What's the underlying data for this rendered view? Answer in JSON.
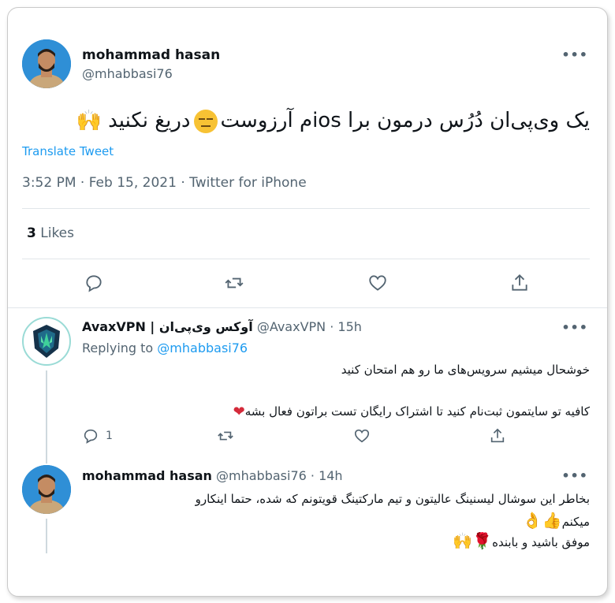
{
  "tweet": {
    "author_name": "mohammad hasan",
    "author_handle": "@mhabbasi76",
    "more_label": "•••",
    "text_before_emoji": "یک وی‌پی‌ان دُرُس درمون برا iosم آرزوست",
    "text_after_emoji": "دریغ نکنید",
    "translate_label": "Translate Tweet",
    "timestamp": "3:52 PM · Feb 15, 2021 · Twitter for iPhone",
    "likes_count": "3",
    "likes_label": "Likes"
  },
  "reply1": {
    "author_name": "AvaxVPN | آوکس وی‌پی‌ان",
    "author_handle": "@AvaxVPN · 15h",
    "replying_prefix": "Replying to",
    "replying_to": "@mhabbasi76",
    "line1": "خوشحال میشیم سرویس‌های ما رو هم امتحان کنید",
    "line2": "کافیه تو سایتمون ثبت‌نام کنید تا اشتراک رایگان تست براتون فعال بشه",
    "reply_count": "1",
    "more_label": "•••"
  },
  "reply2": {
    "author_name": "mohammad hasan",
    "author_handle": "@mhabbasi76 · 14h",
    "line1": "بخاطر این سوشال لیسنینگ عالیتون و تیم مارکتینگ قویتونم که شده، حتما اینکارو",
    "line2": "میکنم",
    "line3": "موفق باشید و بابنده",
    "more_label": "•••"
  },
  "icons": {
    "reply": "reply-icon",
    "retweet": "retweet-icon",
    "like": "heart-icon",
    "share": "share-icon"
  },
  "colors": {
    "accent": "#1d9bf0",
    "text_primary": "#0f1419",
    "text_secondary": "#536471",
    "heart_red": "#d42a3a"
  }
}
